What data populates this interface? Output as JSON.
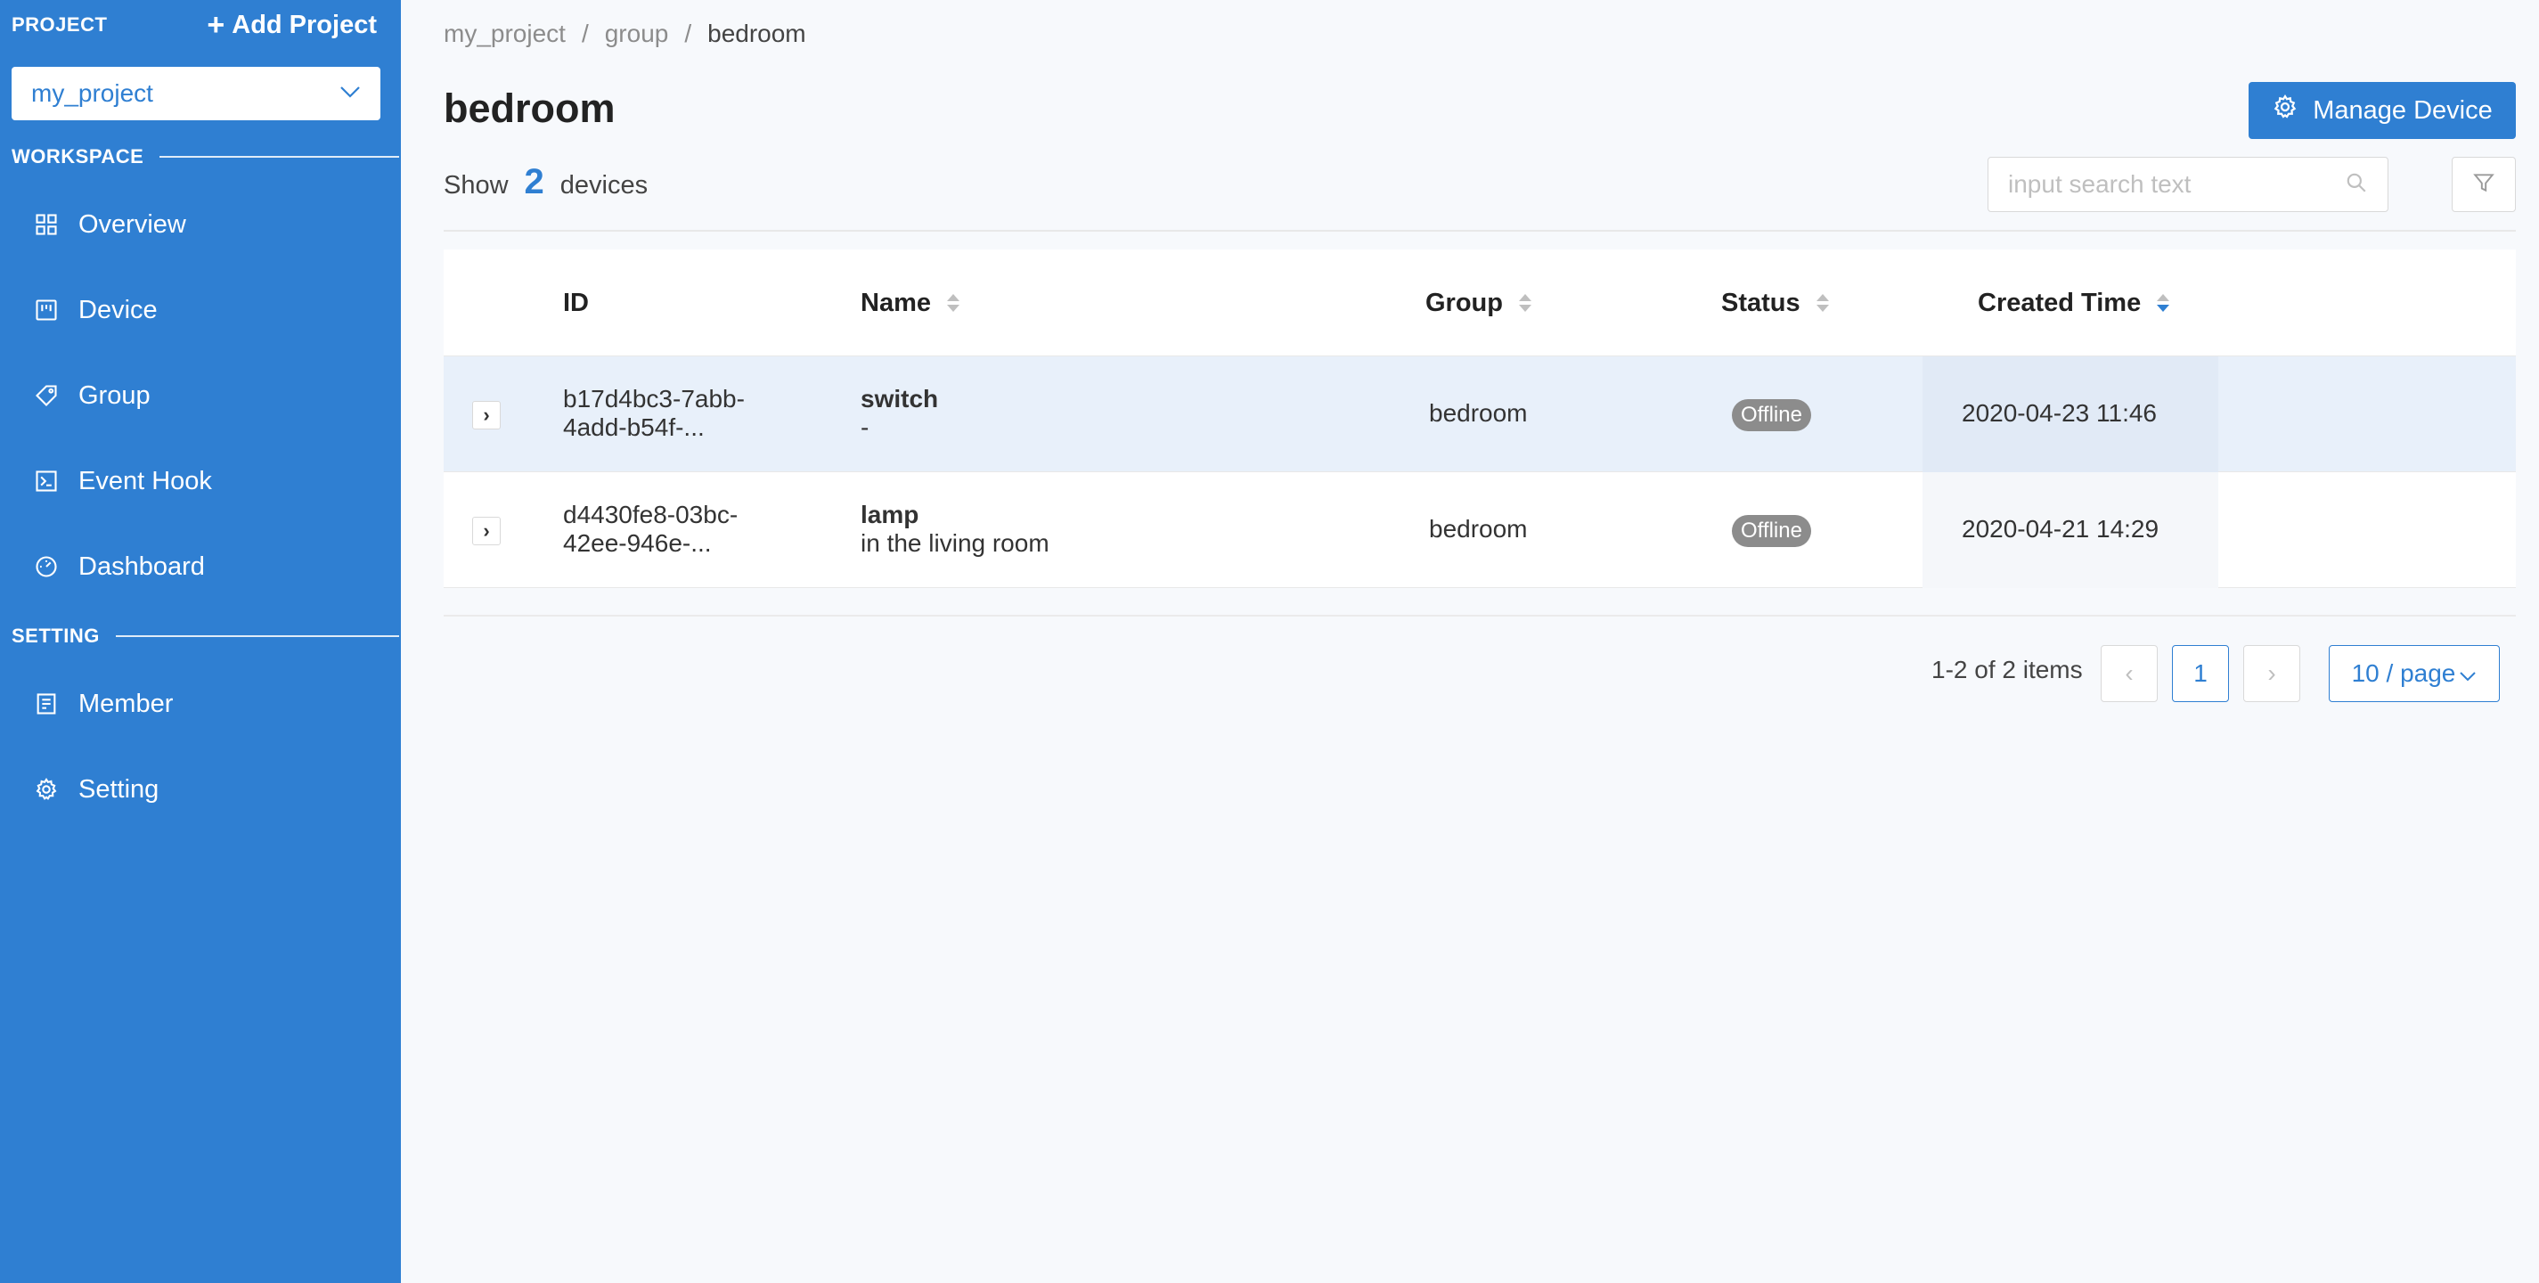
{
  "sidebar": {
    "project_label": "PROJECT",
    "add_project_label": "Add Project",
    "project_select_value": "my_project",
    "workspace_label": "WORKSPACE",
    "setting_label": "SETTING",
    "workspace_items": [
      {
        "label": "Overview",
        "icon": "grid-icon"
      },
      {
        "label": "Device",
        "icon": "device-icon"
      },
      {
        "label": "Group",
        "icon": "tag-icon"
      },
      {
        "label": "Event Hook",
        "icon": "terminal-icon"
      },
      {
        "label": "Dashboard",
        "icon": "gauge-icon"
      }
    ],
    "setting_items": [
      {
        "label": "Member",
        "icon": "member-icon"
      },
      {
        "label": "Setting",
        "icon": "gear-icon"
      }
    ]
  },
  "breadcrumb": [
    "my_project",
    "group",
    "bedroom"
  ],
  "page_title": "bedroom",
  "manage_device_label": "Manage Device",
  "device_count": {
    "prefix": "Show",
    "count": "2",
    "suffix": "devices"
  },
  "search": {
    "placeholder": "input search text",
    "value": ""
  },
  "table": {
    "columns": [
      "ID",
      "Name",
      "Group",
      "Status",
      "Created Time"
    ],
    "rows": [
      {
        "id_line1": "b17d4bc3-7abb-",
        "id_line2": "4add-b54f-...",
        "name": "switch",
        "desc": "-",
        "group": "bedroom",
        "status": "Offline",
        "created": "2020-04-23 11:46"
      },
      {
        "id_line1": "d4430fe8-03bc-",
        "id_line2": "42ee-946e-...",
        "name": "lamp",
        "desc": "in the living room",
        "group": "bedroom",
        "status": "Offline",
        "created": "2020-04-21 14:29"
      }
    ]
  },
  "pagination": {
    "total_text": "1-2 of 2 items",
    "current_page": "1",
    "page_size": "10 / page"
  },
  "colors": {
    "primary": "#2f7fd2",
    "sidebar_bg": "#2f7fd2",
    "status_offline": "#8c8c8c"
  }
}
